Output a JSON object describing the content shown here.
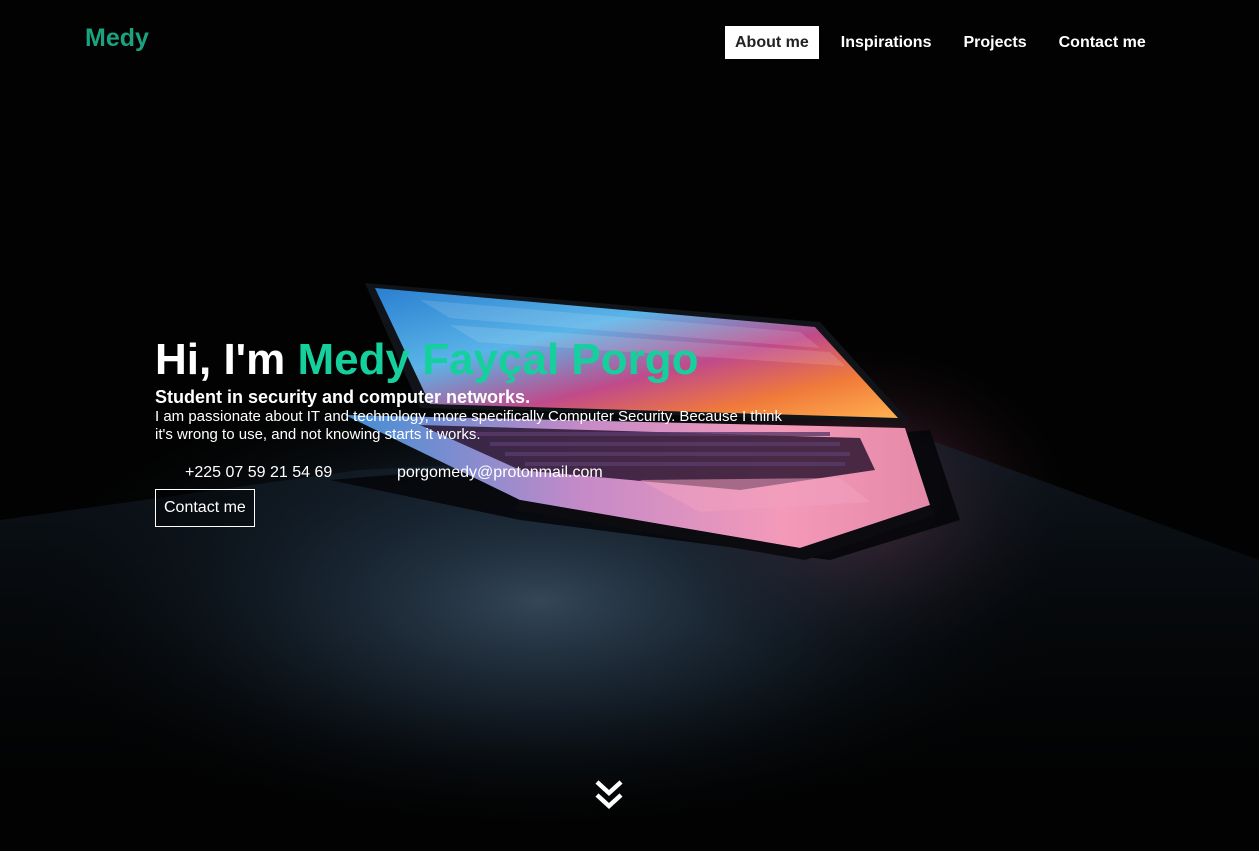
{
  "brand": {
    "logo": "Medy",
    "accent_color": "#15d09d"
  },
  "nav": {
    "items": [
      {
        "label": "About me",
        "active": true
      },
      {
        "label": "Inspirations",
        "active": false
      },
      {
        "label": "Projects",
        "active": false
      },
      {
        "label": "Contact me",
        "active": false
      }
    ]
  },
  "hero": {
    "greeting": "Hi, I'm",
    "name": "Medy Fayçal Porgo",
    "subtitle": "Student in security and computer networks.",
    "description": "I am passionate about IT and technology, more specifically Computer Security. Because I think it's wrong to use, and not knowing starts it works.",
    "phone": "+225 07 59 21 54 69",
    "email": "porgomedy@protonmail.com",
    "contact_button": "Contact me"
  },
  "scroll": {
    "icon": "double-chevron-down-icon"
  }
}
